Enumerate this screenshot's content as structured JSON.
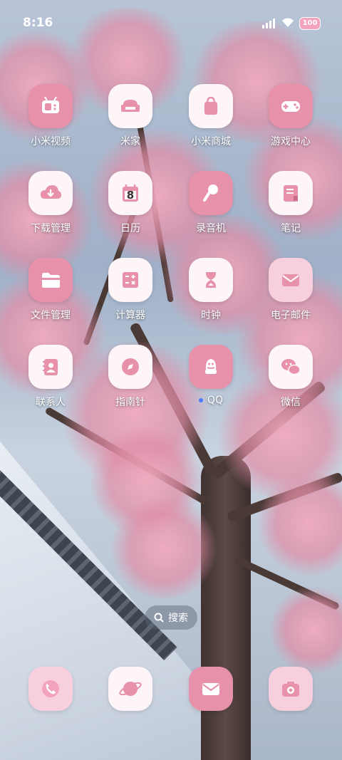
{
  "status": {
    "time": "8:16",
    "battery": "100"
  },
  "apps": [
    {
      "label": "小米视频",
      "icon": "tv-icon",
      "style": "pink"
    },
    {
      "label": "米家",
      "icon": "armchair-icon",
      "style": "white"
    },
    {
      "label": "小米商城",
      "icon": "shopping-bag-icon",
      "style": "white"
    },
    {
      "label": "游戏中心",
      "icon": "gamepad-icon",
      "style": "pink"
    },
    {
      "label": "下载管理",
      "icon": "cloud-download-icon",
      "style": "white"
    },
    {
      "label": "日历",
      "icon": "calendar-icon",
      "style": "white",
      "badge": "8"
    },
    {
      "label": "录音机",
      "icon": "microphone-icon",
      "style": "pink"
    },
    {
      "label": "笔记",
      "icon": "notebook-icon",
      "style": "white"
    },
    {
      "label": "文件管理",
      "icon": "folder-icon",
      "style": "pink"
    },
    {
      "label": "计算器",
      "icon": "calculator-icon",
      "style": "white"
    },
    {
      "label": "时钟",
      "icon": "hourglass-icon",
      "style": "white"
    },
    {
      "label": "电子邮件",
      "icon": "envelope-icon",
      "style": "light"
    },
    {
      "label": "联系人",
      "icon": "contact-book-icon",
      "style": "white"
    },
    {
      "label": "指南针",
      "icon": "compass-icon",
      "style": "white"
    },
    {
      "label": "QQ",
      "icon": "penguin-icon",
      "style": "pink"
    },
    {
      "label": "微信",
      "icon": "wechat-icon",
      "style": "white"
    }
  ],
  "search": {
    "label": "搜索"
  },
  "dock": [
    {
      "icon": "phone-icon",
      "style": "light"
    },
    {
      "icon": "browser-planet-icon",
      "style": "white"
    },
    {
      "icon": "messages-icon",
      "style": "pink"
    },
    {
      "icon": "camera-icon",
      "style": "light"
    }
  ],
  "colors": {
    "accent_pink": "#e891ab",
    "light_pink": "#f8cfdc",
    "icon_white": "#fdf5f7"
  }
}
